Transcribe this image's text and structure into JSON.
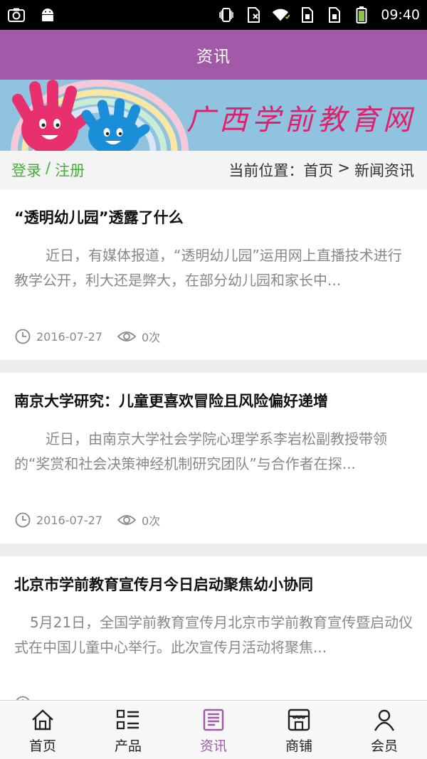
{
  "status_bar": {
    "time": "09:40",
    "left_icons": [
      "screenshot-icon",
      "android-icon"
    ],
    "right_icons": [
      "vibrate-icon",
      "no-sim-icon",
      "wifi-icon",
      "sim-card-icon",
      "sim-card-icon",
      "battery-icon"
    ]
  },
  "header": {
    "title": "资讯",
    "color": "#a25aa8"
  },
  "banner": {
    "text": "广西学前教育网",
    "text_color": "#e0206a",
    "background": "#8fc3df"
  },
  "nav": {
    "login": "登录",
    "separator": "/",
    "register": "注册",
    "breadcrumb_prefix": "当前位置：",
    "breadcrumb_home": "首页",
    "breadcrumb_arrow": ">",
    "breadcrumb_current": "新闻资讯",
    "login_color": "#4aab3e"
  },
  "news": [
    {
      "title": "“透明幼儿园”透露了什么",
      "summary": "近日，有媒体报道，“透明幼儿园”运用网上直播技术进行教学公开，利大还是弊大，在部分幼儿园和家长中...",
      "date": "2016-07-27",
      "views": "0次"
    },
    {
      "title": "南京大学研究：儿童更喜欢冒险且风险偏好递增",
      "summary": "近日，由南京大学社会学院心理学系李岩松副教授带领的“奖赏和社会决策神经机制研究团队”与合作者在探...",
      "date": "2016-07-27",
      "views": "0次"
    },
    {
      "title": "北京市学前教育宣传月今日启动聚焦幼小协同",
      "summary": "5月21日，全国学前教育宣传月北京市学前教育宣传暨启动仪式在中国儿童中心举行。此次宣传月活动将聚焦...",
      "date": "",
      "views": ""
    }
  ],
  "tabs": [
    {
      "label": "首页",
      "icon": "home-icon",
      "active": false
    },
    {
      "label": "产品",
      "icon": "product-list-icon",
      "active": false
    },
    {
      "label": "资讯",
      "icon": "news-icon",
      "active": true
    },
    {
      "label": "商铺",
      "icon": "shop-icon",
      "active": false
    },
    {
      "label": "会员",
      "icon": "member-icon",
      "active": false
    }
  ],
  "accent_color": "#a25aa8"
}
